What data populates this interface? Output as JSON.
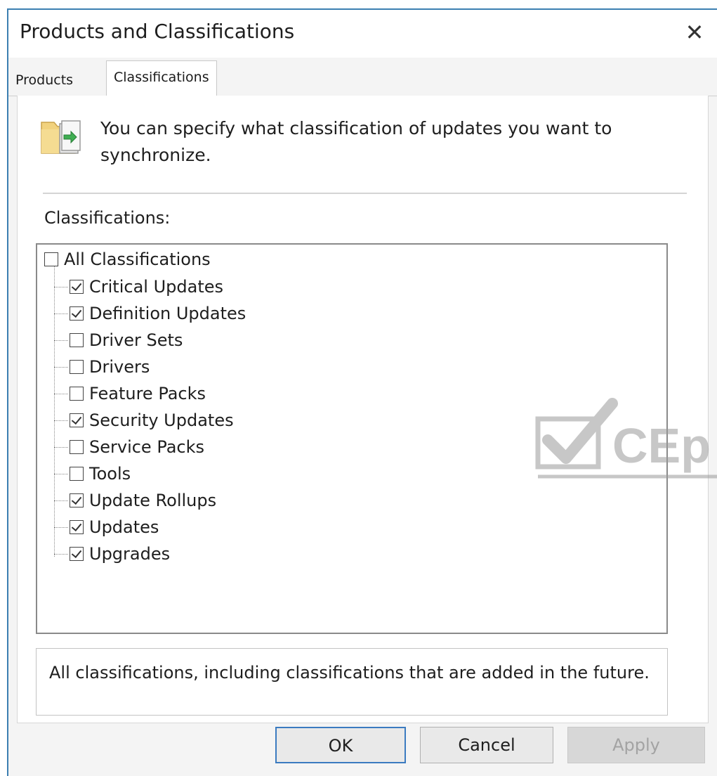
{
  "window": {
    "title": "Products and Classifications",
    "close_glyph": "✕"
  },
  "tabs": [
    {
      "label": "Products",
      "selected": false
    },
    {
      "label": "Classifications",
      "selected": true
    }
  ],
  "intro": {
    "icon": "folder-sync-icon",
    "text": "You can specify what classification of updates you want to synchronize."
  },
  "classifications": {
    "label": "Classifications:",
    "root": {
      "label": "All Classifications",
      "checked": false
    },
    "items": [
      {
        "label": "Critical Updates",
        "checked": true
      },
      {
        "label": "Definition Updates",
        "checked": true
      },
      {
        "label": "Driver Sets",
        "checked": false
      },
      {
        "label": "Drivers",
        "checked": false
      },
      {
        "label": "Feature Packs",
        "checked": false
      },
      {
        "label": "Security Updates",
        "checked": true
      },
      {
        "label": "Service Packs",
        "checked": false
      },
      {
        "label": "Tools",
        "checked": false
      },
      {
        "label": "Update Rollups",
        "checked": true
      },
      {
        "label": "Updates",
        "checked": true
      },
      {
        "label": "Upgrades",
        "checked": true
      }
    ]
  },
  "description": "All classifications, including classifications that are added in the future.",
  "buttons": {
    "ok": "OK",
    "cancel": "Cancel",
    "apply": "Apply"
  },
  "watermark": {
    "text": "CEp"
  },
  "colors": {
    "accent_border": "#3b7bc0",
    "disabled_text": "#a3a3a3"
  }
}
